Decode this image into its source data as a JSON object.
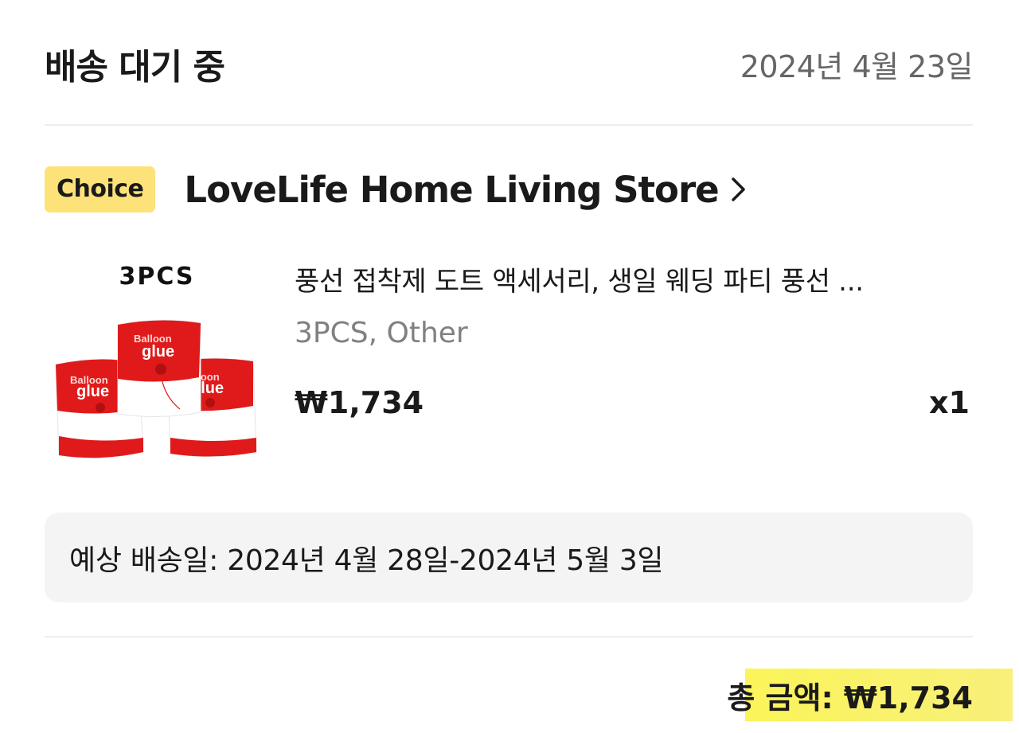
{
  "header": {
    "status": "배송 대기 중",
    "date": "2024년 4월 23일"
  },
  "store": {
    "badge": "Choice",
    "name": "LoveLife Home Living Store",
    "chevron_icon": "chevron-right-icon"
  },
  "product": {
    "image_caption": "3PCS",
    "title": "풍선 접착제 도트 액세서리, 생일 웨딩 파티 풍선 ...",
    "variant": "3PCS, Other",
    "price": "₩1,734",
    "quantity": "x1"
  },
  "delivery": {
    "text": "예상 배송일: 2024년 4월 28일-2024년 5월 3일"
  },
  "total": {
    "text": "총 금액: ₩1,734"
  },
  "colors": {
    "badge_bg": "#fde27a",
    "highlight": "#fbf45a",
    "product_red": "#e01a1a"
  }
}
